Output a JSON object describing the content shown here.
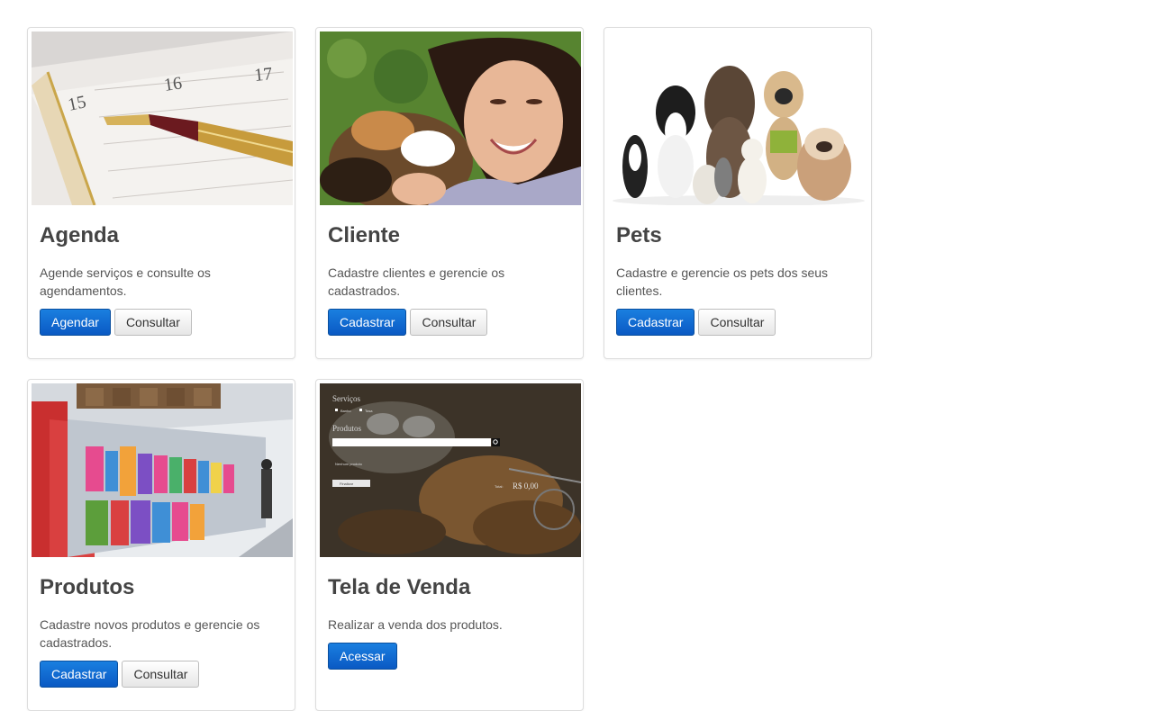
{
  "cards": [
    {
      "title": "Agenda",
      "description": "Agende serviços e consulte os agendamentos.",
      "primary_label": "Agendar",
      "secondary_label": "Consultar",
      "image_icon": "calendar-pen-photo",
      "page_numbers": [
        "15",
        "16",
        "17"
      ]
    },
    {
      "title": "Cliente",
      "description": "Cadastre clientes e gerencie os cadastrados.",
      "primary_label": "Cadastrar",
      "secondary_label": "Consultar",
      "image_icon": "woman-with-dog-photo"
    },
    {
      "title": "Pets",
      "description": "Cadastre e gerencie os pets dos seus clientes.",
      "primary_label": "Cadastrar",
      "secondary_label": "Consultar",
      "image_icon": "dogs-group-photo"
    },
    {
      "title": "Produtos",
      "description": "Cadastre novos produtos e gerencie os cadastrados.",
      "primary_label": "Cadastrar",
      "secondary_label": "Consultar",
      "image_icon": "pet-store-shelves-photo"
    },
    {
      "title": "Tela de Venda",
      "description": "Realizar a venda dos produtos.",
      "primary_label": "Acessar",
      "image_icon": "sales-screen-preview",
      "preview": {
        "services_label": "Serviços",
        "service_options": [
          "Banho",
          "Tosa"
        ],
        "products_label": "Produtos",
        "empty_label": "Nenhum produto",
        "finish_label": "Finalizar",
        "total_label": "Total:",
        "total_value": "R$ 0,00"
      }
    }
  ],
  "colors": {
    "primary": "#0a59c3",
    "border": "#dddddd"
  }
}
